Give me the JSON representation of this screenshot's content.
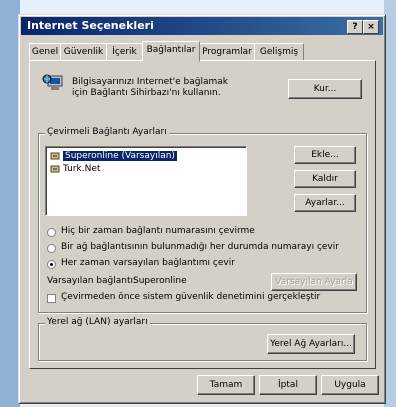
{
  "window": {
    "title": "Internet Seçenekleri",
    "help_label": "?",
    "close_label": "×"
  },
  "tabs": [
    {
      "label": "Genel"
    },
    {
      "label": "Güvenlik"
    },
    {
      "label": "İçerik"
    },
    {
      "label": "Bağlantılar"
    },
    {
      "label": "Programlar"
    },
    {
      "label": "Gelişmiş"
    }
  ],
  "setup": {
    "text": "Bilgisayarınızı Internet'e bağlamak için Bağlantı Sihirbazı'nı kullanın.",
    "button": "Kur..."
  },
  "dialup": {
    "group_label": "Çevirmeli Bağlantı Ayarları",
    "items": [
      {
        "label": "Superonline (Varsayılan)",
        "selected": true
      },
      {
        "label": "Turk.Net",
        "selected": false
      }
    ],
    "add_button": "Ekle...",
    "remove_button": "Kaldır",
    "settings_button": "Ayarlar...",
    "options": [
      {
        "label": "Hiç bir zaman bağlantı numarasını çevirme",
        "checked": false
      },
      {
        "label": "Bir ağ bağlantısının bulunmadığı her durumda numarayı çevir",
        "checked": false
      },
      {
        "label": "Her zaman varsayılan bağlantımı çevir",
        "checked": true
      }
    ],
    "current_label": "Varsayılan bağlantı:",
    "current_value": "Superonline",
    "set_default_button": "Varsayılan Ayarla",
    "security_check_label": "Çevirmeden önce sistem güvenlik denetimini gerçekleştir"
  },
  "lan": {
    "group_label": "Yerel ağ (LAN) ayarları",
    "button": "Yerel Ağ Ayarları..."
  },
  "footer": {
    "ok": "Tamam",
    "cancel": "İptal",
    "apply": "Uygula"
  }
}
